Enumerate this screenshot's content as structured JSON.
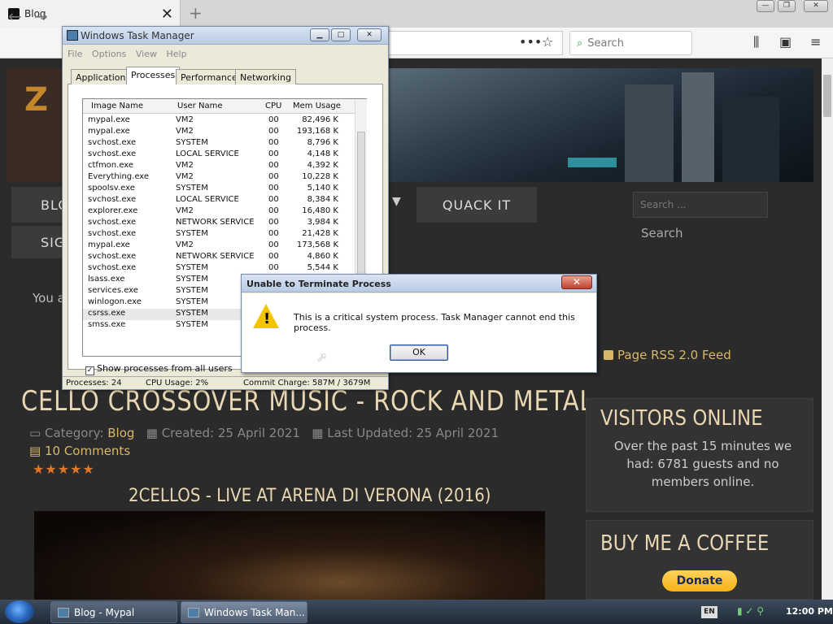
{
  "browser": {
    "tab_title": "Blog",
    "search_placeholder": "Search",
    "win_min": "—",
    "win_max": "❐",
    "win_close": "✕"
  },
  "page": {
    "menu_blog": "BLOG",
    "menu_sign": "SIGN",
    "menu_quack": "QUACK IT",
    "search_placeholder": "Search ...",
    "search_button": "Search",
    "you_are": "You a",
    "rss": "Page RSS 2.0 Feed",
    "article_title": "CELLO CROSSOVER MUSIC - ROCK AND METAL",
    "category_label": "Category:",
    "category_value": "Blog",
    "created": "Created: 25 April 2021",
    "updated": "Last Updated: 25 April 2021",
    "comments": "10 Comments",
    "rating_stars": 5,
    "subtitle": "2CELLOS - LIVE AT ARENA DI VERONA (2016)",
    "visitors_heading": "VISITORS ONLINE",
    "visitors_text": "Over the past 15 minutes we had: 6781 guests and no members online.",
    "coffee_heading": "BUY ME A COFFEE",
    "donate": "Donate"
  },
  "task_manager": {
    "title": "Windows Task Manager",
    "menu": [
      "File",
      "Options",
      "View",
      "Help"
    ],
    "tabs": [
      "Applications",
      "Processes",
      "Performance",
      "Networking"
    ],
    "active_tab": "Processes",
    "columns": [
      "Image Name",
      "User Name",
      "CPU",
      "Mem Usage"
    ],
    "rows": [
      [
        "mypal.exe",
        "VM2",
        "00",
        "82,496 K"
      ],
      [
        "mypal.exe",
        "VM2",
        "00",
        "193,168 K"
      ],
      [
        "svchost.exe",
        "SYSTEM",
        "00",
        "8,796 K"
      ],
      [
        "svchost.exe",
        "LOCAL SERVICE",
        "00",
        "4,148 K"
      ],
      [
        "ctfmon.exe",
        "VM2",
        "00",
        "4,392 K"
      ],
      [
        "Everything.exe",
        "VM2",
        "00",
        "10,228 K"
      ],
      [
        "spoolsv.exe",
        "SYSTEM",
        "00",
        "5,140 K"
      ],
      [
        "svchost.exe",
        "LOCAL SERVICE",
        "00",
        "8,384 K"
      ],
      [
        "explorer.exe",
        "VM2",
        "00",
        "16,480 K"
      ],
      [
        "svchost.exe",
        "NETWORK SERVICE",
        "00",
        "3,984 K"
      ],
      [
        "svchost.exe",
        "SYSTEM",
        "00",
        "21,428 K"
      ],
      [
        "mypal.exe",
        "VM2",
        "00",
        "173,568 K"
      ],
      [
        "svchost.exe",
        "NETWORK SERVICE",
        "00",
        "4,860 K"
      ],
      [
        "svchost.exe",
        "SYSTEM",
        "00",
        "5,544 K"
      ],
      [
        "lsass.exe",
        "SYSTEM",
        "",
        ""
      ],
      [
        "services.exe",
        "SYSTEM",
        "",
        ""
      ],
      [
        "winlogon.exe",
        "SYSTEM",
        "",
        ""
      ],
      [
        "csrss.exe",
        "SYSTEM",
        "",
        ""
      ],
      [
        "smss.exe",
        "SYSTEM",
        "",
        ""
      ]
    ],
    "selected_row": "csrss.exe",
    "show_all_label": "Show processes from all users",
    "status_processes": "Processes: 24",
    "status_cpu": "CPU Usage: 2%",
    "status_commit": "Commit Charge: 587M / 3679M"
  },
  "error_dialog": {
    "title": "Unable to Terminate Process",
    "message": "This is a critical system process.  Task Manager cannot end this process.",
    "ok": "OK"
  },
  "taskbar": {
    "tasks": [
      "Blog - Mypal",
      "Windows Task Man..."
    ],
    "lang": "EN",
    "clock": "12:00 PM"
  }
}
